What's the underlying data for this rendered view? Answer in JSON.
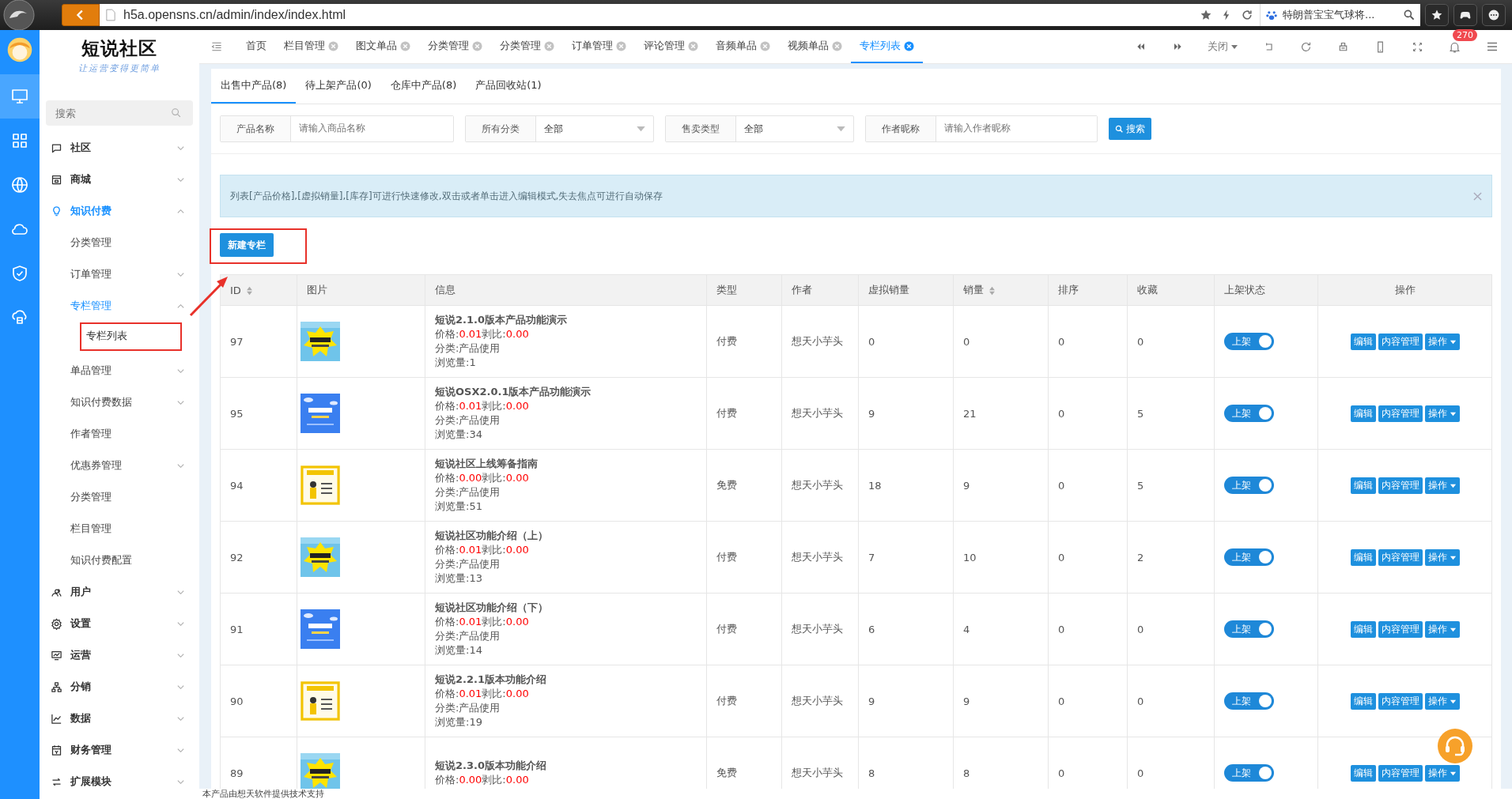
{
  "browser": {
    "url": "h5a.opensns.cn/admin/index/index.html",
    "search_text": "特朗普宝宝气球将..."
  },
  "rail": [
    {
      "selected": true
    },
    {
      "selected": false
    },
    {
      "selected": false
    },
    {
      "selected": false
    },
    {
      "selected": false
    },
    {
      "selected": false
    }
  ],
  "sidebar": {
    "logo": "短说社区",
    "slogan": "让运营变得更简单",
    "search": {
      "placeholder": "搜索"
    },
    "items": [
      {
        "label": "社区",
        "kind": "menu",
        "expanded": false,
        "selected": false
      },
      {
        "label": "商城",
        "kind": "menu",
        "expanded": false,
        "selected": false
      },
      {
        "label": "知识付费",
        "kind": "menu",
        "expanded": true,
        "selected": true,
        "children": [
          {
            "label": "分类管理",
            "kind": "link",
            "selected": false
          },
          {
            "label": "订单管理",
            "kind": "menu",
            "expanded": false,
            "selected": false
          },
          {
            "label": "专栏管理",
            "kind": "menu",
            "expanded": true,
            "selected": true,
            "children": [
              {
                "label": "专栏列表",
                "selected": true
              }
            ]
          },
          {
            "label": "单品管理",
            "kind": "menu",
            "expanded": false,
            "selected": false
          },
          {
            "label": "知识付费数据",
            "kind": "menu",
            "expanded": false,
            "selected": false
          },
          {
            "label": "作者管理",
            "kind": "link",
            "selected": false
          },
          {
            "label": "优惠券管理",
            "kind": "menu",
            "expanded": false,
            "selected": false
          },
          {
            "label": "分类管理",
            "kind": "link",
            "selected": false
          },
          {
            "label": "栏目管理",
            "kind": "link",
            "selected": false
          },
          {
            "label": "知识付费配置",
            "kind": "link",
            "selected": false
          }
        ]
      },
      {
        "label": "用户",
        "kind": "menu",
        "expanded": false,
        "selected": false
      },
      {
        "label": "设置",
        "kind": "menu",
        "expanded": false,
        "selected": false
      },
      {
        "label": "运营",
        "kind": "menu",
        "expanded": false,
        "selected": false
      },
      {
        "label": "分销",
        "kind": "menu",
        "expanded": false,
        "selected": false
      },
      {
        "label": "数据",
        "kind": "menu",
        "expanded": false,
        "selected": false
      },
      {
        "label": "财务管理",
        "kind": "menu",
        "expanded": false,
        "selected": false
      },
      {
        "label": "扩展模块",
        "kind": "menu",
        "expanded": false,
        "selected": false
      }
    ]
  },
  "page_tabs": [
    {
      "label": "首页",
      "closable": false,
      "selected": false
    },
    {
      "label": "栏目管理",
      "closable": true,
      "selected": false
    },
    {
      "label": "图文单品",
      "closable": true,
      "selected": false
    },
    {
      "label": "分类管理",
      "closable": true,
      "selected": false
    },
    {
      "label": "分类管理",
      "closable": true,
      "selected": false
    },
    {
      "label": "订单管理",
      "closable": true,
      "selected": false
    },
    {
      "label": "评论管理",
      "closable": true,
      "selected": false
    },
    {
      "label": "音频单品",
      "closable": true,
      "selected": false
    },
    {
      "label": "视频单品",
      "closable": true,
      "selected": false
    },
    {
      "label": "专栏列表",
      "closable": true,
      "selected": true
    }
  ],
  "toolbar": {
    "close_menu": "关闭",
    "notifications": "270"
  },
  "sub_tabs": [
    {
      "label": "出售中产品(8)",
      "selected": true
    },
    {
      "label": "待上架产品(0)",
      "selected": false
    },
    {
      "label": "仓库中产品(8)",
      "selected": false
    },
    {
      "label": "产品回收站(1)",
      "selected": false
    }
  ],
  "filters": [
    {
      "label": "产品名称",
      "kind": "input",
      "placeholder": "请输入商品名称"
    },
    {
      "label": "所有分类",
      "kind": "select",
      "value": "全部"
    },
    {
      "label": "售卖类型",
      "kind": "select",
      "value": "全部"
    },
    {
      "label": "作者昵称",
      "kind": "input",
      "placeholder": "请输入作者昵称"
    }
  ],
  "search_button": "搜索",
  "notice": "列表[产品价格],[虚拟销量],[库存]可进行快速修改,双击或者单击进入编辑模式,失去焦点可进行自动保存",
  "new_button": "新建专栏",
  "table": {
    "columns": [
      {
        "label": "ID",
        "sortable": true
      },
      {
        "label": "图片",
        "sortable": false
      },
      {
        "label": "信息",
        "sortable": false
      },
      {
        "label": "类型",
        "sortable": false
      },
      {
        "label": "作者",
        "sortable": false
      },
      {
        "label": "虚拟销量",
        "sortable": false
      },
      {
        "label": "销量",
        "sortable": true
      },
      {
        "label": "排序",
        "sortable": false
      },
      {
        "label": "收藏",
        "sortable": false
      },
      {
        "label": "上架状态",
        "sortable": false
      },
      {
        "label": "操作",
        "sortable": false
      }
    ],
    "rows": [
      {
        "id": "97",
        "title": "短说2.1.0版本产品功能演示",
        "price_label": "价格:",
        "price": "0.01",
        "ratio_label": "剥比:",
        "ratio": "0.00",
        "category": "分类:产品使用",
        "views": "浏览量:1",
        "type": "付费",
        "author": "想天小芋头",
        "virtual_sales": "0",
        "sales": "0",
        "sort": "0",
        "favorites": "0",
        "status": {
          "label": "上架",
          "on": true
        },
        "actions": [
          "编辑",
          "内容管理",
          "操作"
        ]
      },
      {
        "id": "95",
        "title": "短说OSX2.0.1版本产品功能演示",
        "price_label": "价格:",
        "price": "0.01",
        "ratio_label": "剥比:",
        "ratio": "0.00",
        "category": "分类:产品使用",
        "views": "浏览量:34",
        "type": "付费",
        "author": "想天小芋头",
        "virtual_sales": "9",
        "sales": "21",
        "sort": "0",
        "favorites": "5",
        "status": {
          "label": "上架",
          "on": true
        },
        "actions": [
          "编辑",
          "内容管理",
          "操作"
        ]
      },
      {
        "id": "94",
        "title": "短说社区上线筹备指南",
        "price_label": "价格:",
        "price": "0.00",
        "ratio_label": "剥比:",
        "ratio": "0.00",
        "category": "分类:产品使用",
        "views": "浏览量:51",
        "type": "免费",
        "author": "想天小芋头",
        "virtual_sales": "18",
        "sales": "9",
        "sort": "0",
        "favorites": "5",
        "status": {
          "label": "上架",
          "on": true
        },
        "actions": [
          "编辑",
          "内容管理",
          "操作"
        ]
      },
      {
        "id": "92",
        "title": "短说社区功能介绍（上）",
        "price_label": "价格:",
        "price": "0.01",
        "ratio_label": "剥比:",
        "ratio": "0.00",
        "category": "分类:产品使用",
        "views": "浏览量:13",
        "type": "付费",
        "author": "想天小芋头",
        "virtual_sales": "7",
        "sales": "10",
        "sort": "0",
        "favorites": "2",
        "status": {
          "label": "上架",
          "on": true
        },
        "actions": [
          "编辑",
          "内容管理",
          "操作"
        ]
      },
      {
        "id": "91",
        "title": "短说社区功能介绍（下）",
        "price_label": "价格:",
        "price": "0.01",
        "ratio_label": "剥比:",
        "ratio": "0.00",
        "category": "分类:产品使用",
        "views": "浏览量:14",
        "type": "付费",
        "author": "想天小芋头",
        "virtual_sales": "6",
        "sales": "4",
        "sort": "0",
        "favorites": "0",
        "status": {
          "label": "上架",
          "on": true
        },
        "actions": [
          "编辑",
          "内容管理",
          "操作"
        ]
      },
      {
        "id": "90",
        "title": "短说2.2.1版本功能介绍",
        "price_label": "价格:",
        "price": "0.01",
        "ratio_label": "剥比:",
        "ratio": "0.00",
        "category": "分类:产品使用",
        "views": "浏览量:19",
        "type": "付费",
        "author": "想天小芋头",
        "virtual_sales": "9",
        "sales": "9",
        "sort": "0",
        "favorites": "0",
        "status": {
          "label": "上架",
          "on": true
        },
        "actions": [
          "编辑",
          "内容管理",
          "操作"
        ]
      },
      {
        "id": "89",
        "title": "短说2.3.0版本功能介绍",
        "price_label": "价格:",
        "price": "0.00",
        "ratio_label": "剥比:",
        "ratio": "0.00",
        "type": "免费",
        "author": "想天小芋头",
        "virtual_sales": "8",
        "sales": "8",
        "sort": "0",
        "favorites": "0",
        "status": {
          "label": "上架",
          "on": true
        },
        "actions": [
          "编辑",
          "内容管理",
          "操作"
        ]
      }
    ]
  },
  "footer": "本产品由想天软件提供技术支持"
}
